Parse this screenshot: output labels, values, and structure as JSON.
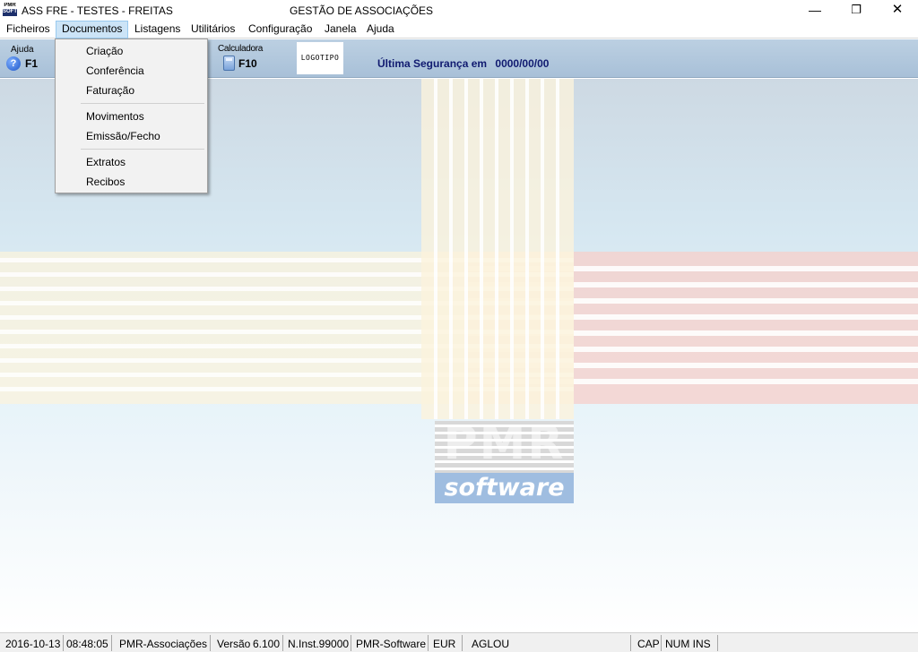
{
  "window": {
    "app_icon_text_top": "PMR",
    "app_icon_text_bottom": "SOFT",
    "title": "ASS FRE - TESTES - FREITAS",
    "center_title": "GESTÃO DE ASSOCIAÇÕES",
    "minimize_glyph": "—",
    "maximize_glyph": "❐",
    "close_glyph": "✕"
  },
  "menu": {
    "items": [
      "Ficheiros",
      "Documentos",
      "Listagens",
      "Utilitários",
      "Configuração",
      "Janela",
      "Ajuda"
    ],
    "active": "Documentos"
  },
  "toolbar": {
    "help_label": "Ajuda",
    "help_key": "F1",
    "help_glyph": "?",
    "calc_label": "Calculadora",
    "calc_key": "F10",
    "logo_text": "LOGOTIPO",
    "backup_label": "Última Segurança em",
    "backup_date": "0000/00/00"
  },
  "dropdown": {
    "group1": [
      "Criação",
      "Conferência",
      "Faturação"
    ],
    "group2": [
      "Movimentos",
      "Emissão/Fecho"
    ],
    "group3": [
      "Extratos",
      "Recibos"
    ]
  },
  "background_logo": {
    "brand_top": "PMR",
    "brand_bottom": "software"
  },
  "status": {
    "date": "2016-10-13",
    "time": "08:48:05",
    "app": "PMR-Associações",
    "version_label": "Versão",
    "version": "6.100",
    "install": "N.Inst.99000",
    "vendor": "PMR-Software",
    "currency": "EUR",
    "user": "AGLOU",
    "cap": "CAP",
    "num_ins": "NUM INS"
  },
  "colors": {
    "menu_active_bg": "#cce4f7",
    "toolbar_bg": "#b3c8dc",
    "backup_text": "#101a70",
    "logo_blue": "#7fa8d8"
  }
}
